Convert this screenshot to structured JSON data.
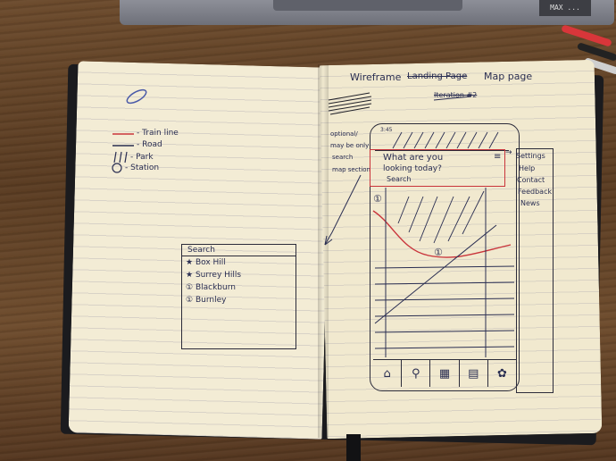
{
  "left_page": {
    "legend": [
      {
        "label": "- Train line",
        "color": "#c9343b"
      },
      {
        "label": "- Road",
        "color": "#2a2e52"
      },
      {
        "label": "- Park"
      },
      {
        "label": "- Station"
      }
    ],
    "search_panel": {
      "title": "Search",
      "items": [
        {
          "icon": "★",
          "label": "Box Hill"
        },
        {
          "icon": "★",
          "label": "Surrey Hills"
        },
        {
          "icon": "①",
          "label": "Blackburn"
        },
        {
          "icon": "①",
          "label": "Burnley"
        }
      ]
    }
  },
  "right_page": {
    "title": "Wireframe",
    "title_struck": "Landing Page",
    "title_right": "Map page",
    "subtitle_struck": "Iteration #2",
    "annotations": {
      "a1": "optional/",
      "a2": "may be only",
      "a3": "search",
      "a4": "map section"
    },
    "phone": {
      "status_text": "3:45",
      "banner_line1": "What are you",
      "banner_line2": "looking today?",
      "banner_line3": "Search",
      "menu_icon": "≡",
      "station_marker": "①",
      "nav_icons": [
        "⌂",
        "⚲",
        "▦",
        "▤",
        "✿"
      ]
    },
    "side_menu": {
      "arrow": "→",
      "items": [
        "Settings",
        "Help",
        "Contact",
        "Feedback",
        "News"
      ]
    }
  },
  "laptop_sticker": "MAX ..."
}
